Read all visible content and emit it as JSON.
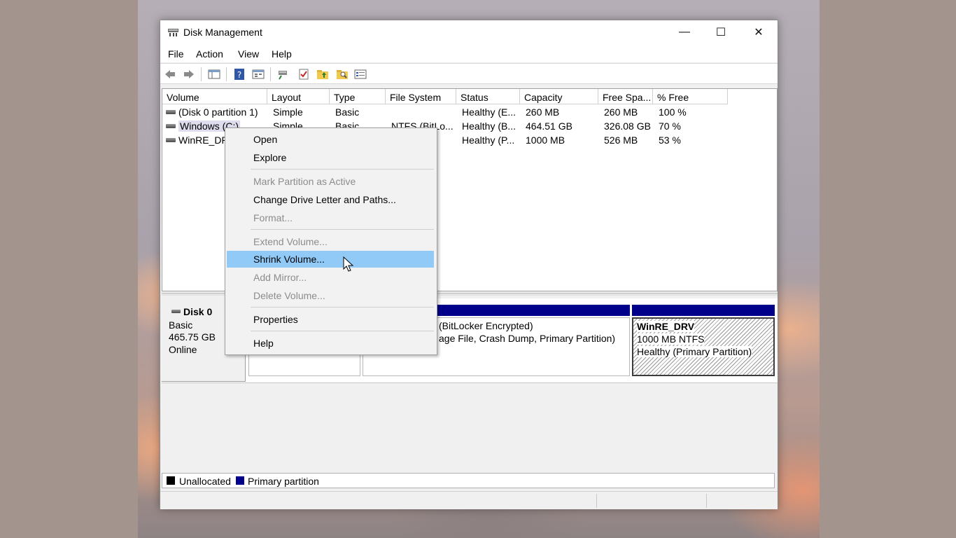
{
  "window": {
    "title": "Disk Management",
    "controls": {
      "minimize": "—",
      "maximize": "☐",
      "close": "✕"
    }
  },
  "menu": [
    "File",
    "Action",
    "View",
    "Help"
  ],
  "toolbar_icons": [
    "back-arrow-icon",
    "forward-arrow-icon",
    "console-tree-icon",
    "help-icon",
    "properties-view-icon",
    "connect-icon",
    "check-icon",
    "folder-up-icon",
    "folder-search-icon",
    "settings-list-icon"
  ],
  "columns": [
    "Volume",
    "Layout",
    "Type",
    "File System",
    "Status",
    "Capacity",
    "Free Spa...",
    "% Free"
  ],
  "rows": [
    {
      "volume": "(Disk 0 partition 1)",
      "layout": "Simple",
      "type": "Basic",
      "fs": "",
      "status": "Healthy (E...",
      "capacity": "260 MB",
      "free": "260 MB",
      "pct": "100 %"
    },
    {
      "volume": "Windows (C:)",
      "layout": "Simple",
      "type": "Basic",
      "fs": "NTFS (BitLo...",
      "status": "Healthy (B...",
      "capacity": "464.51 GB",
      "free": "326.08 GB",
      "pct": "70 %"
    },
    {
      "volume": "WinRE_DRV",
      "layout": "",
      "type": "",
      "fs": "",
      "status": "Healthy (P...",
      "capacity": "1000 MB",
      "free": "526 MB",
      "pct": "53 %"
    }
  ],
  "disk": {
    "name": "Disk 0",
    "type": "Basic",
    "size": "465.75 GB",
    "state": "Online",
    "partitions": [
      {
        "line1": "",
        "line2": "",
        "line3": ""
      },
      {
        "line1": "",
        "line2": "(BitLocker Encrypted)",
        "line3": "age File, Crash Dump, Primary Partition)"
      },
      {
        "line1": "WinRE_DRV",
        "line2": "1000 MB NTFS",
        "line3": "Healthy (Primary Partition)"
      }
    ]
  },
  "legend": [
    {
      "label": "Unallocated",
      "color": "#000000"
    },
    {
      "label": "Primary partition",
      "color": "#00008b"
    }
  ],
  "context_menu": {
    "items": [
      {
        "label": "Open",
        "enabled": true
      },
      {
        "label": "Explore",
        "enabled": true
      },
      {
        "label": "Mark Partition as Active",
        "enabled": false
      },
      {
        "label": "Change Drive Letter and Paths...",
        "enabled": true
      },
      {
        "label": "Format...",
        "enabled": false
      },
      {
        "label": "Extend Volume...",
        "enabled": false
      },
      {
        "label": "Shrink Volume...",
        "enabled": true,
        "highlighted": true
      },
      {
        "label": "Add Mirror...",
        "enabled": false
      },
      {
        "label": "Delete Volume...",
        "enabled": false
      },
      {
        "label": "Properties",
        "enabled": true
      },
      {
        "label": "Help",
        "enabled": true
      }
    ]
  },
  "colors": {
    "primary_partition": "#00008b",
    "highlight": "#91c9f7"
  }
}
